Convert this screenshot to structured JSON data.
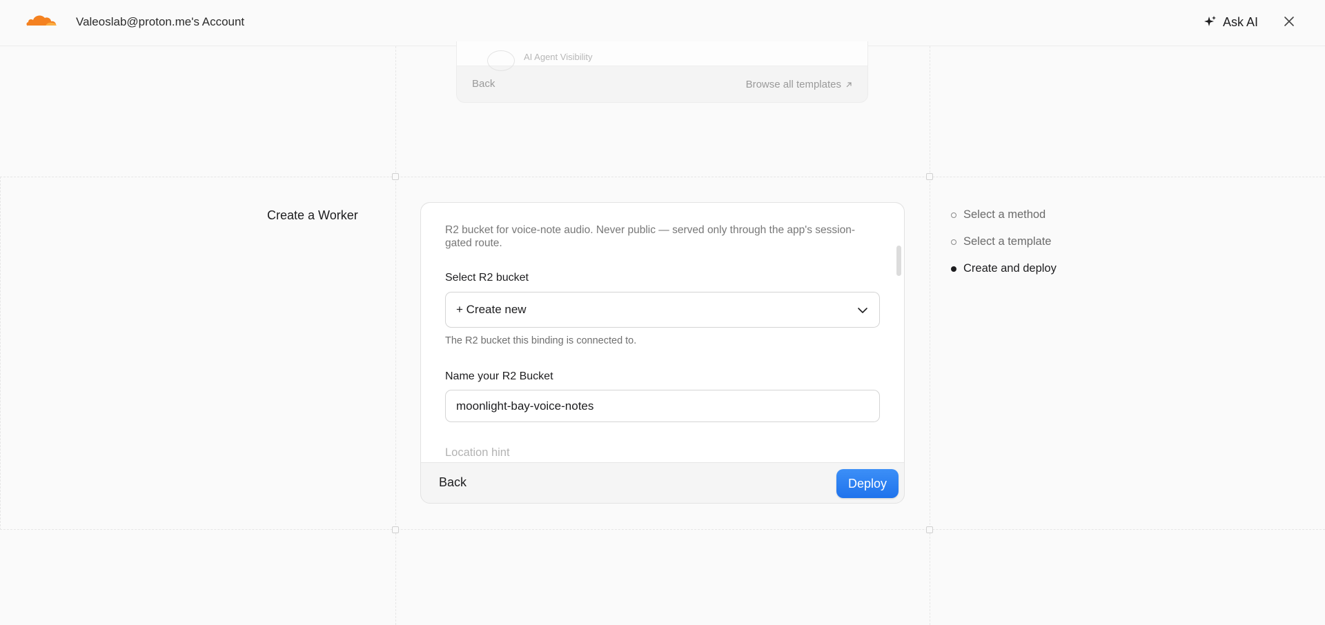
{
  "header": {
    "account": "Valeoslab@proton.me's Account",
    "ask_ai": "Ask AI"
  },
  "previous_card": {
    "item_label": "AI Agent Visibility",
    "back": "Back",
    "browse": "Browse all templates"
  },
  "page": {
    "title": "Create a Worker"
  },
  "form": {
    "description": "R2 bucket for voice-note audio. Never public — served only through the app's session-gated route.",
    "select_label": "Select R2 bucket",
    "select_value": "+ Create new",
    "select_help": "The R2 bucket this binding is connected to.",
    "name_label": "Name your R2 Bucket",
    "name_value": "moonlight-bay-voice-notes",
    "location_label": "Location hint"
  },
  "footer": {
    "back": "Back",
    "deploy": "Deploy"
  },
  "steps": [
    {
      "label": "Select a method",
      "active": false
    },
    {
      "label": "Select a template",
      "active": false
    },
    {
      "label": "Create and deploy",
      "active": true
    }
  ],
  "colors": {
    "accent": "#1f73ec",
    "brand_orange": "#f48120"
  },
  "icons": {
    "logo": "cloudflare-logo",
    "ask_ai": "sparkle-icon",
    "close": "close-icon",
    "chevron": "chevron-down-icon",
    "external": "external-link-icon"
  }
}
